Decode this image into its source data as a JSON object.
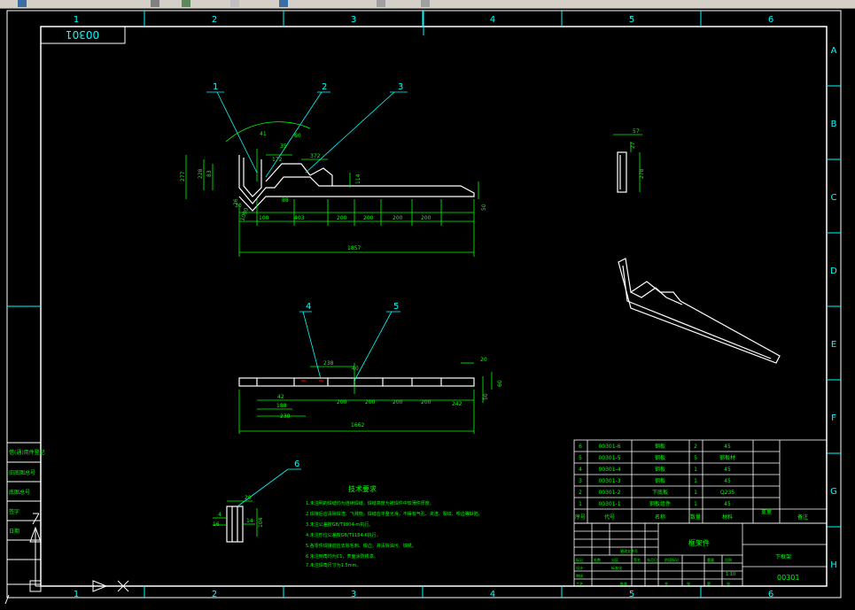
{
  "frame": {
    "col_labels": [
      "1",
      "2",
      "3",
      "4",
      "5",
      "6"
    ],
    "row_labels": [
      "A",
      "B",
      "C",
      "D",
      "E",
      "F",
      "G",
      "H"
    ],
    "drawing_code_rotated": "00301"
  },
  "view1": {
    "callouts": [
      "1",
      "2",
      "3"
    ],
    "dims": {
      "d41": "41",
      "d35": "35",
      "d172": "172",
      "d372": "372",
      "d60": "60",
      "d277": "277",
      "d228": "228",
      "d83": "83",
      "d114": "114",
      "d50": "50",
      "d30": "30",
      "d88": "88",
      "d100": "100",
      "d403": "403",
      "d200a": "200",
      "d200b": "200",
      "d200c": "200",
      "d200d": "200",
      "d1857": "1857",
      "d26": "26",
      "d1000": "1000"
    }
  },
  "view2": {
    "callouts": [
      "4",
      "5"
    ],
    "dims": {
      "d238": "238",
      "d40": "40",
      "d20": "20",
      "d42": "42",
      "d188": "188",
      "d230": "230",
      "d200a": "200",
      "d200b": "200",
      "d200c": "200",
      "d200d": "200",
      "d242": "242",
      "d1662": "1662",
      "d50": "50",
      "d60": "60"
    }
  },
  "side_view": {
    "dims": {
      "d57": "57",
      "d27": "27",
      "d278": "278"
    }
  },
  "section_view": {
    "callout": "6",
    "dims": {
      "d20": "20",
      "d4": "4",
      "d16": "16",
      "d14": "14",
      "d104": "104"
    }
  },
  "notes": {
    "title": "技术要求",
    "lines": [
      "1.未注明的焊缝均为连续焊缝，焊缝高度为被焊件中较薄件厚度。",
      "2.焊接后应清除焊渣、飞溅物，焊缝应平整光滑，不得有气孔、夹渣、裂纹、咬边等缺陷。",
      "3.未注公差按GB/T1804-m执行。",
      "4.未注形位公差按GB/T1184-K执行。",
      "5.各零件焊接前应去除毛刺、锐边，并清除油污、铁锈。",
      "6.未注倒角均为C1，表面涂防锈漆。",
      "7.未注焊角尺寸为1.5mm。"
    ]
  },
  "bom": {
    "rows": [
      {
        "no": "6",
        "code": "00301-6",
        "name": "钢板",
        "qty": "2",
        "material": "45"
      },
      {
        "no": "5",
        "code": "00301-5",
        "name": "钢板",
        "qty": "5",
        "material": "钢板材"
      },
      {
        "no": "4",
        "code": "00301-4",
        "name": "钢板",
        "qty": "1",
        "material": "45"
      },
      {
        "no": "3",
        "code": "00301-3",
        "name": "钢板",
        "qty": "1",
        "material": "45"
      },
      {
        "no": "2",
        "code": "00301-2",
        "name": "下底板",
        "qty": "1",
        "material": "Q235"
      },
      {
        "no": "1",
        "code": "00301-1",
        "name": "钢板组件",
        "qty": "1",
        "material": "45"
      }
    ],
    "header": {
      "no": "序号",
      "code": "代号",
      "name": "名称",
      "qty": "数量",
      "material": "材料",
      "weight": "重量",
      "remark": "备注"
    }
  },
  "title_block": {
    "part_name": "框架件",
    "drawing_no": "00301",
    "scale": "1:10",
    "company": "下框架",
    "labels": [
      "标记",
      "处数",
      "分区",
      "更改文件号",
      "签名",
      "年月日",
      "设计",
      "标准化",
      "审核",
      "工艺",
      "批准",
      "阶段标记",
      "重量",
      "比例",
      "共",
      "张",
      "第",
      "张"
    ]
  },
  "left_strip": [
    "借(通)用件登记",
    "旧底图总号",
    "底图总号",
    "签字",
    "日期"
  ]
}
